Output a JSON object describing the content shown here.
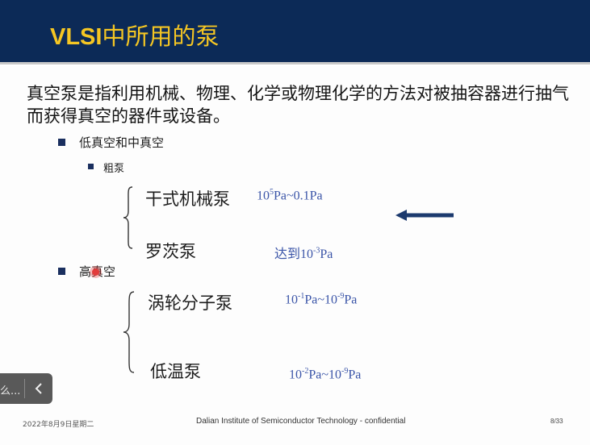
{
  "slide": {
    "title_latin": "VLSI",
    "title_cjk": "中所用的泵",
    "lead": "真空泵是指利用机械、物理、化学或物理化学的方法对被抽容器进行抽气而获得真空的器件或设备。",
    "section1": "低真空和中真空",
    "sub1": "粗泵",
    "group1": [
      {
        "name": "干式机械泵",
        "range_pre": "10",
        "range_sup": "5",
        "range_post": "Pa~0.1Pa"
      },
      {
        "name": "罗茨泵",
        "range_pre": "达到10",
        "range_sup": "-3",
        "range_post": "Pa"
      }
    ],
    "section2": "高真空",
    "group2": [
      {
        "name": "涡轮分子泵",
        "range_pre": "10",
        "range_sup": "-1",
        "range_mid": "Pa~10",
        "range_sup2": "-9",
        "range_post": "Pa"
      },
      {
        "name": "低温泵",
        "range_pre": "10",
        "range_sup": "-2",
        "range_mid": "Pa~10",
        "range_sup2": "-9",
        "range_post": "Pa"
      }
    ]
  },
  "footer": {
    "date": "2022年8月9日星期二",
    "center": "Dalian Institute of Semiconductor Technology - confidential",
    "page": "8/33"
  },
  "side_panel": {
    "text": "么...",
    "back_icon": "chevron-left-icon"
  },
  "colors": {
    "header_bg": "#0c2a57",
    "title": "#f5c623",
    "range_text": "#3b55a8",
    "arrow": "#1c3a6e"
  }
}
